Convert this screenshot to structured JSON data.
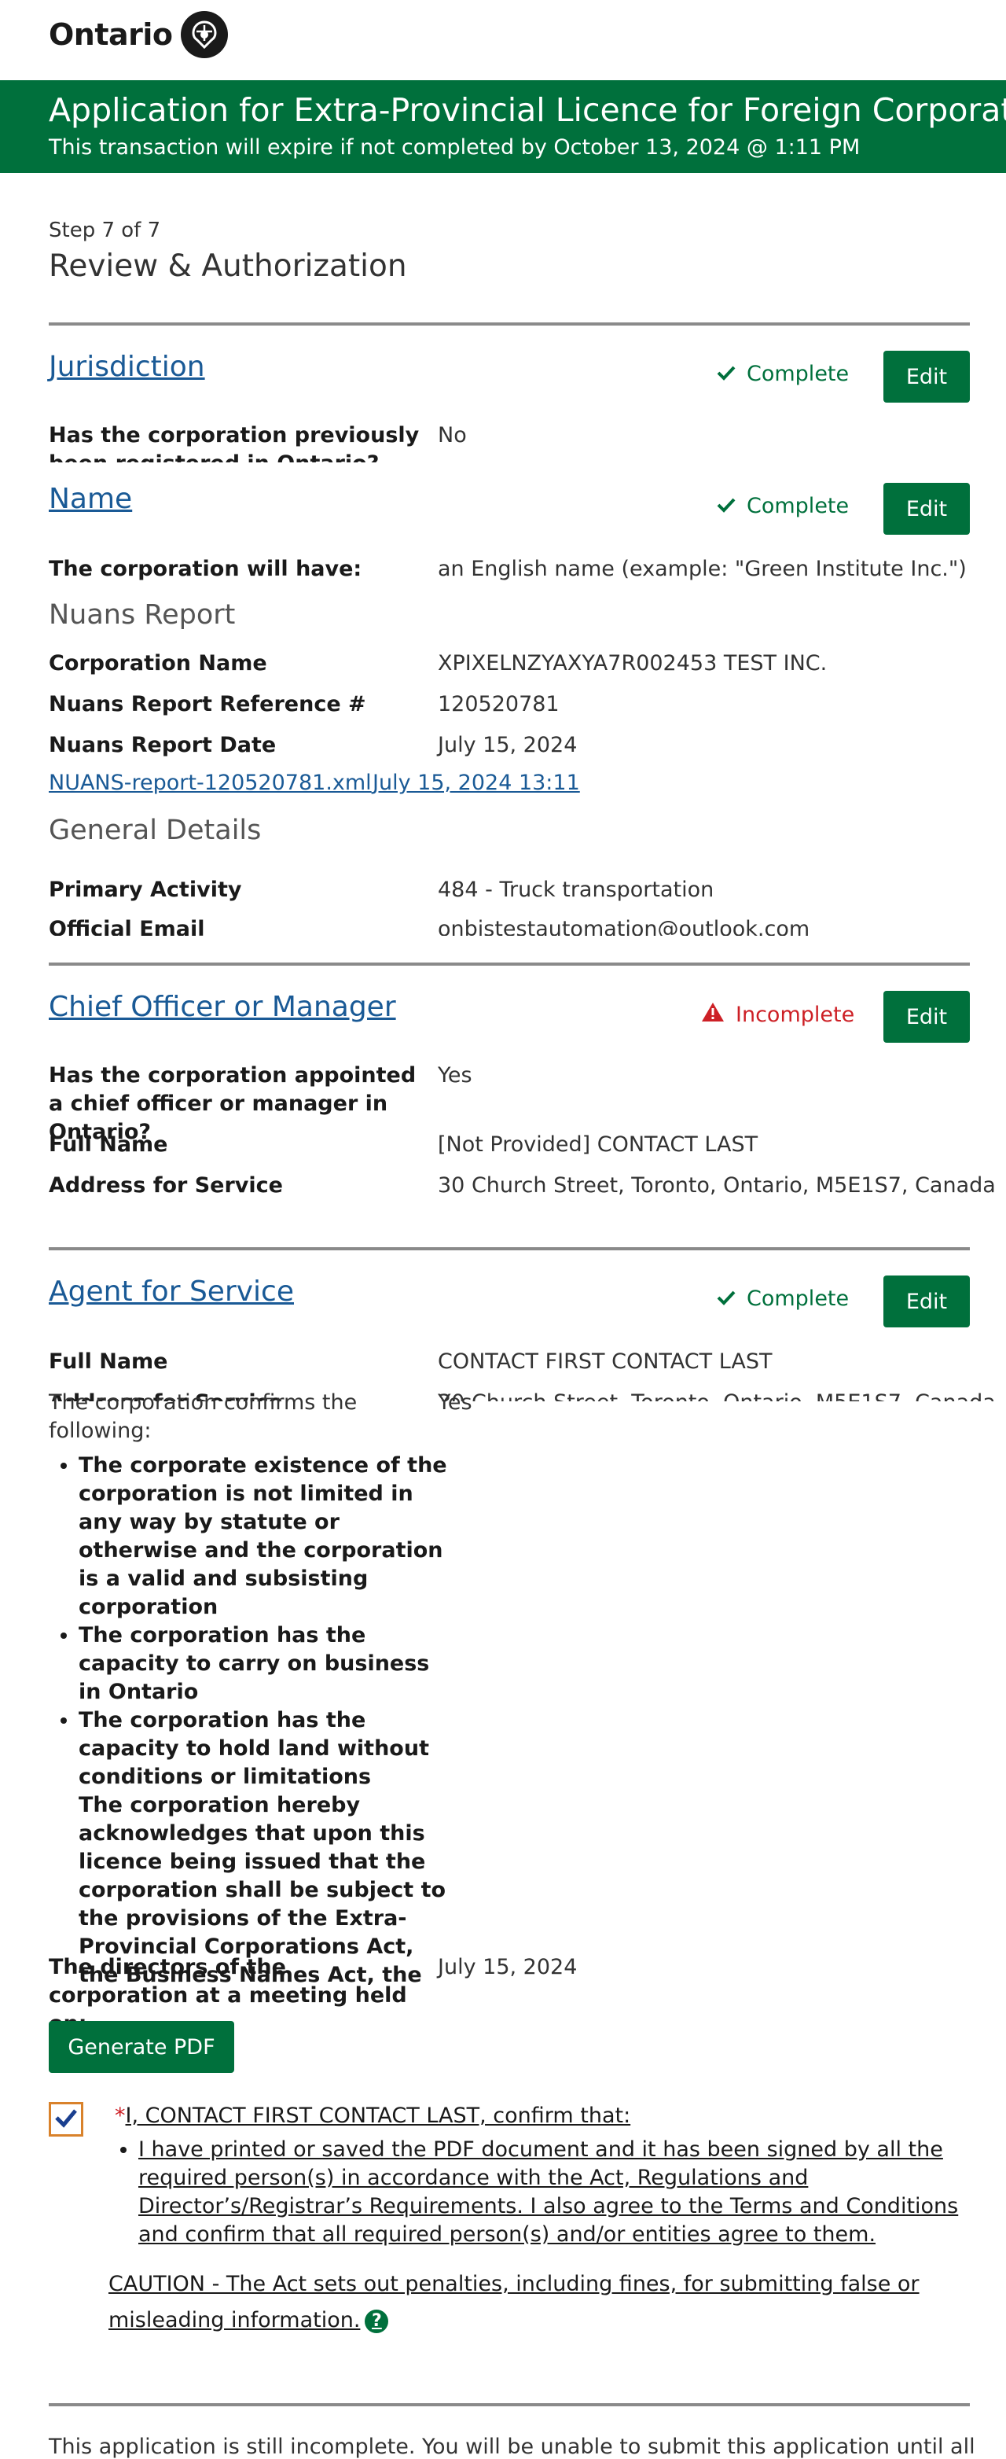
{
  "brand": {
    "wordmark": "Ontario"
  },
  "banner": {
    "title": "Application for Extra-Provincial Licence for Foreign Corporation",
    "subtitle": "This transaction will expire if not completed by October 13, 2024 @ 1:11 PM"
  },
  "step": {
    "label": "Step 7 of 7",
    "title": "Review & Authorization"
  },
  "jurisdiction": {
    "title": "Jurisdiction",
    "status": "Complete",
    "edit_label": "Edit",
    "q_label": "Has the corporation previously been registered in Ontario?",
    "q_value": "No"
  },
  "name": {
    "title": "Name",
    "status": "Complete",
    "edit_label": "Edit",
    "will_have_label": "The corporation will have:",
    "will_have_value": "an English name (example: \"Green Institute Inc.\")",
    "nuans_heading": "Nuans Report",
    "corp_name_label": "Corporation Name",
    "corp_name_value": "XPIXELNZYAXYA7R002453 TEST INC.",
    "ref_label": "Nuans Report Reference #",
    "ref_value": "120520781",
    "date_label": "Nuans Report Date",
    "date_value": "July 15, 2024",
    "file_link": "NUANS-report-120520781.xml",
    "file_timestamp": "July 15, 2024 13:11",
    "general_heading": "General Details",
    "activity_label": "Primary Activity",
    "activity_value": "484 - Truck transportation",
    "email_label": "Official Email",
    "email_value": "onbistestautomation@outlook.com"
  },
  "chief": {
    "title": "Chief Officer or Manager",
    "status": "Incomplete",
    "edit_label": "Edit",
    "q_label": "Has the corporation appointed a chief officer or manager in Ontario?",
    "q_value": "Yes",
    "full_name_label": "Full Name",
    "full_name_value": "[Not Provided] CONTACT LAST",
    "address_label": "Address for Service",
    "address_value": "30 Church Street, Toronto, Ontario, M5E1S7, Canada"
  },
  "agent": {
    "title": "Agent for Service",
    "status": "Complete",
    "edit_label": "Edit",
    "full_name_label": "Full Name",
    "full_name_value": "CONTACT FIRST CONTACT LAST",
    "address_label": "Address for Service",
    "address_value": "30 Church Street, Toronto, Ontario, M5E1S7, Canada"
  },
  "confirm": {
    "label": "The corporation confirms the following:",
    "value": "Yes",
    "items": [
      "The corporate existence of the corporation is not limited in any way by statute or otherwise and the corporation is a valid and subsisting corporation",
      "The corporation has the capacity to carry on business in Ontario",
      "The corporation has the capacity to hold land without conditions or limitations",
      "The corporation hereby acknowledges that upon this licence being issued that the corporation shall be subject to the provisions of the Extra-Provincial Corporations Act, the Business Names Act, the Corporations Information Act, and to such further and other legislative provisions as the Legislature of Ontario may deem expedient in order to secure the due management of the corporation's affairs and the protection of its creditors within Ontario."
    ]
  },
  "directors": {
    "label": "The directors of the corporation at a meeting held on:",
    "value": "July 15, 2024"
  },
  "generate_pdf_label": "Generate PDF",
  "declaration": {
    "required_mark": "*",
    "lead": "I, CONTACT FIRST CONTACT LAST, confirm that:",
    "item": "I have printed or saved the PDF document and it has been signed by all the required person(s) in accordance with the Act, Regulations and Director’s/Registrar’s Requirements. I also agree to the Terms and Conditions and confirm that all required person(s) and/or entities agree to them.",
    "caution": "CAUTION - The Act sets out penalties, including fines, for submitting false or misleading information.",
    "help_glyph": "?"
  },
  "footer_note": "This application is still incomplete. You will be unable to submit this application until all"
}
